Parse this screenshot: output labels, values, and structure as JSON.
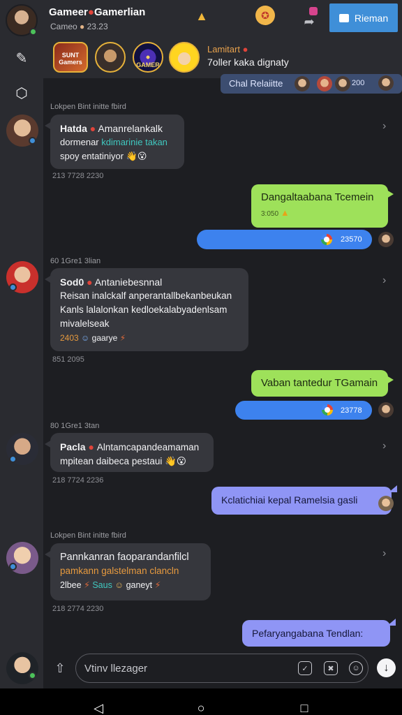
{
  "header": {
    "title": "Gameer",
    "title_suffix": "Gamerlian",
    "subtitle": "Cameo",
    "subtitle_count": "23.23",
    "button_label": "Rieman",
    "icons": [
      "trophy-icon",
      "award-badge-icon",
      "share-arrow-icon",
      "chat-icon"
    ]
  },
  "stories": {
    "items": [
      {
        "label": "SUNT Gamers"
      },
      {
        "label": ""
      },
      {
        "label": "GAMER"
      },
      {
        "label": ""
      }
    ],
    "featured_name": "Lamitart",
    "featured_text": "7oller kaka dignaty"
  },
  "rail": {
    "icons": [
      "edit-icon",
      "settings-icon"
    ]
  },
  "pinned": {
    "label": "Chal Relaiitte",
    "count": "200"
  },
  "messages": [
    {
      "header": "Lokpen Bint initte fbird",
      "sender": "Hatda",
      "text1": "Amanrelankalk",
      "text2a": "dormenar ",
      "text2b": "kdimarinie takan",
      "text3": "spoy entatiniyor",
      "timestamp": "213 7728 2230"
    },
    {
      "outgoing_green": "Dangaltaabana Tcemein",
      "outgoing_green_time": "3:050",
      "outgoing_blue_time": "23570"
    },
    {
      "header": "60 1Gre1 3lian",
      "sender": "Sod0",
      "text1": "Antaniebesnnal",
      "text2": "Reisan inalckalf anperantallbekanbeukan",
      "text3": "Kanls lalalonkan kedloekalabyadenlsam",
      "text4": "mivalelseak",
      "tag_num": "2403",
      "tag_text": "gaarye",
      "timestamp": "851 2095"
    },
    {
      "outgoing_green": "Vaban tantedur TGamain",
      "outgoing_blue_time": "23778"
    },
    {
      "header": "80 1Gre1 3tan",
      "sender": "Pacla",
      "text1": "Alntamcapandeamaman",
      "text2": "mpitean daibeca pestaui",
      "timestamp": "218 7724 2236"
    },
    {
      "outgoing_violet": "Kclatichiai kepal Ramelsia gasli"
    },
    {
      "header": "Lokpen Bint initte fbird",
      "text1": "Pannkanran faoparandanfilcl",
      "text2": "pamkann galstelman clancln",
      "tag_num": "2lbee",
      "tag_text": "Saus",
      "tag_text2": "ganeyt",
      "timestamp": "218 2774 2230"
    },
    {
      "outgoing_violet": "Pefaryangabana Tendlan:"
    }
  ],
  "composer": {
    "placeholder": "Vtinv llezager"
  },
  "colors": {
    "background": "#1d1e22",
    "panel": "#2a2b30",
    "bubble": "#36373d",
    "green": "#9ee15a",
    "blue": "#3d82ee",
    "violet": "#8f95f5",
    "accent": "#3f8fd8"
  }
}
